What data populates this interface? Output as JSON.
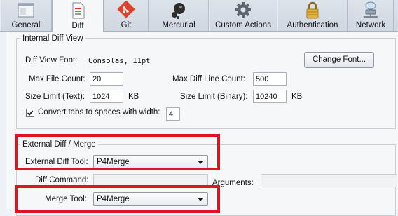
{
  "tabs": [
    {
      "label": "General",
      "icon": "window-icon"
    },
    {
      "label": "Diff",
      "icon": "document-icon"
    },
    {
      "label": "Git",
      "icon": "git-icon"
    },
    {
      "label": "Mercurial",
      "icon": "mercurial-icon"
    },
    {
      "label": "Custom Actions",
      "icon": "gear-icon"
    },
    {
      "label": "Authentication",
      "icon": "lock-icon"
    },
    {
      "label": "Network",
      "icon": "network-icon"
    }
  ],
  "active_tab": "Diff",
  "internal": {
    "title": "Internal Diff View",
    "font_label": "Diff View Font:",
    "font_value": "Consolas, 11pt",
    "change_font_button": "Change Font...",
    "max_file_count_label": "Max File Count:",
    "max_file_count_value": "20",
    "max_diff_line_label": "Max Diff Line Count:",
    "max_diff_line_value": "500",
    "size_limit_text_label": "Size Limit (Text):",
    "size_limit_text_value": "1024",
    "kb1": "KB",
    "size_limit_binary_label": "Size Limit (Binary):",
    "size_limit_binary_value": "10240",
    "kb2": "KB",
    "convert_tabs_label": "Convert tabs to spaces with width:",
    "convert_tabs_checked": true,
    "tab_width_value": "4"
  },
  "external": {
    "title": "External Diff / Merge",
    "diff_tool_label": "External Diff Tool:",
    "diff_tool_value": "P4Merge",
    "diff_command_label": "Diff Command:",
    "diff_command_value": "",
    "arguments_label": "Arguments:",
    "arguments_value": "",
    "merge_tool_label": "Merge Tool:",
    "merge_tool_value": "P4Merge"
  },
  "highlight_color": "#e0141e"
}
